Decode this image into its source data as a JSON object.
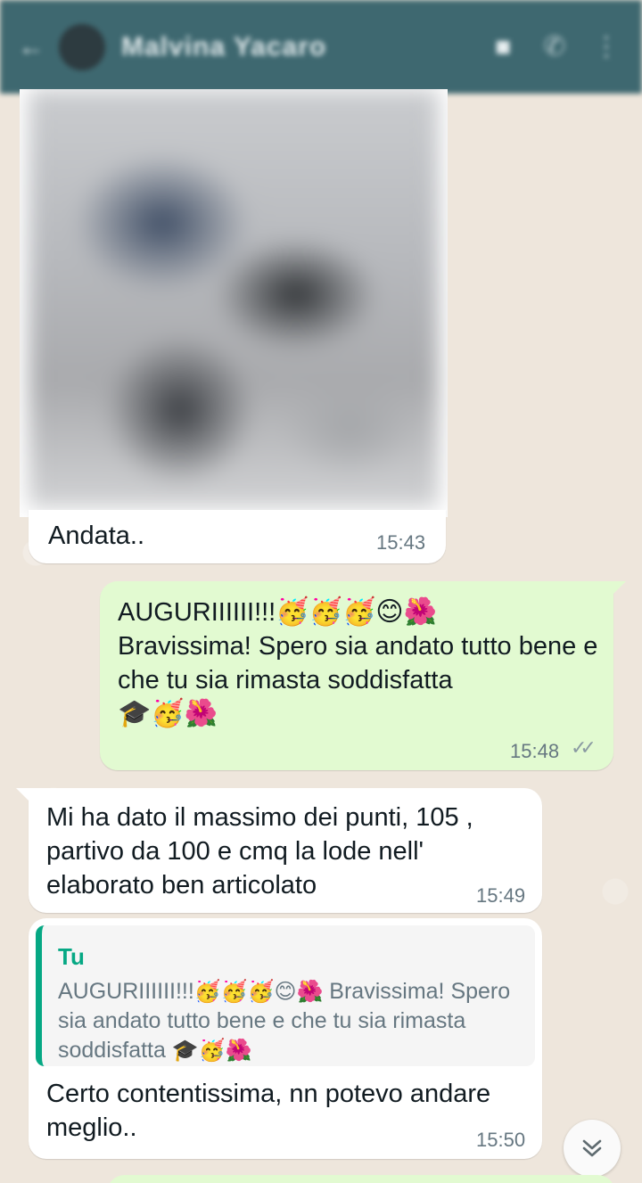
{
  "header": {
    "contact_name": "Malvina Yacaro"
  },
  "messages": [
    {
      "type": "image",
      "direction": "incoming",
      "caption": "Andata..",
      "time": "15:43"
    },
    {
      "type": "text",
      "direction": "outgoing",
      "line1_text": "AUGURIIIIII!!!",
      "line1_emoji": "🥳🥳🥳😊🌺",
      "text": "Bravissima! Spero sia andato tutto bene e che tu sia rimasta soddisfatta",
      "trailing_emoji": "🎓🥳🌺",
      "time": "15:48",
      "status": "read",
      "status_glyph": "✓✓"
    },
    {
      "type": "text",
      "direction": "incoming",
      "text": "Mi ha dato il massimo dei punti, 105 , partivo da 100 e cmq la lode nell' elaborato ben articolato",
      "time": "15:49"
    },
    {
      "type": "reply",
      "direction": "incoming",
      "quoted_author": "Tu",
      "quoted_text_start": "AUGURIIIIII!!!",
      "quoted_emoji1": "🥳🥳🥳😊🌺",
      "quoted_text_mid": " Bravissima! Spero sia andato tutto bene e che tu sia rimasta soddisfatta ",
      "quoted_emoji2": "🎓🥳🌺",
      "text": "Certo contentissima, nn potevo andare meglio..",
      "time": "15:50"
    }
  ],
  "colors": {
    "header_bg": "#3e6870",
    "outgoing_bubble": "#e2fad1",
    "incoming_bubble": "#ffffff",
    "quote_accent": "#06a884",
    "timestamp": "#667781"
  }
}
